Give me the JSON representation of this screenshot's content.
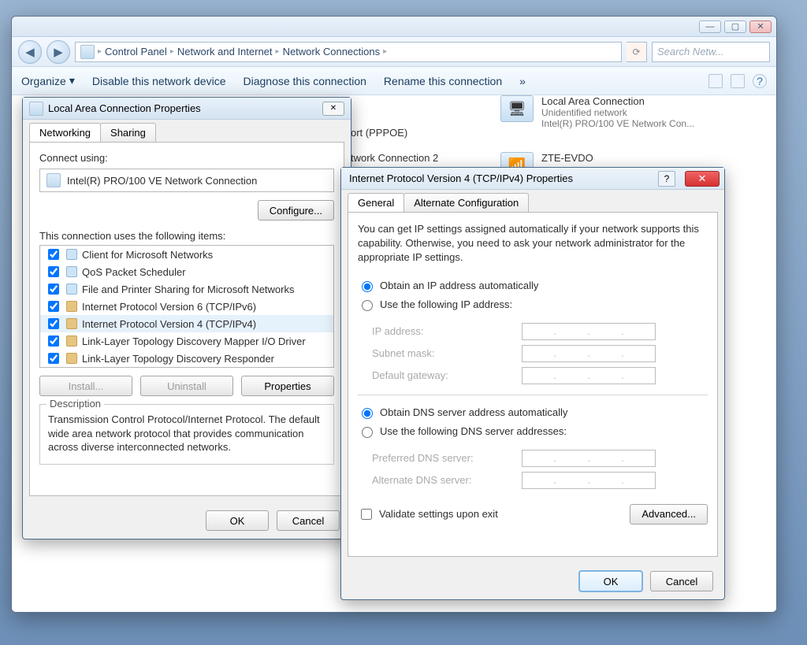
{
  "explorer": {
    "breadcrumb": {
      "part1": "Control Panel",
      "part2": "Network and Internet",
      "part3": "Network Connections"
    },
    "search_placeholder": "Search Netw...",
    "toolbar": {
      "organize": "Organize",
      "disable": "Disable this network device",
      "diagnose": "Diagnose this connection",
      "rename": "Rename this connection"
    },
    "connections": {
      "pppoe": "ort (PPPOE)",
      "bbconn2": "twork Connection 2",
      "lan_title": "Local Area Connection",
      "lan_status": "Unidentified network",
      "lan_adapter": "Intel(R) PRO/100 VE Network Con...",
      "zte": "ZTE-EVDO"
    }
  },
  "lacprops": {
    "title": "Local Area Connection Properties",
    "tabs": {
      "networking": "Networking",
      "sharing": "Sharing"
    },
    "connect_using_label": "Connect using:",
    "adapter": "Intel(R) PRO/100 VE Network Connection",
    "configure_btn": "Configure...",
    "items_label": "This connection uses the following items:",
    "items": [
      "Client for Microsoft Networks",
      "QoS Packet Scheduler",
      "File and Printer Sharing for Microsoft Networks",
      "Internet Protocol Version 6 (TCP/IPv6)",
      "Internet Protocol Version 4 (TCP/IPv4)",
      "Link-Layer Topology Discovery Mapper I/O Driver",
      "Link-Layer Topology Discovery Responder"
    ],
    "install_btn": "Install...",
    "uninstall_btn": "Uninstall",
    "properties_btn": "Properties",
    "description_label": "Description",
    "description_text": "Transmission Control Protocol/Internet Protocol. The default wide area network protocol that provides communication across diverse interconnected networks.",
    "ok": "OK",
    "cancel": "Cancel"
  },
  "ipv4": {
    "title": "Internet Protocol Version 4 (TCP/IPv4) Properties",
    "tabs": {
      "general": "General",
      "altconfig": "Alternate Configuration"
    },
    "intro": "You can get IP settings assigned automatically if your network supports this capability. Otherwise, you need to ask your network administrator for the appropriate IP settings.",
    "obtain_ip": "Obtain an IP address automatically",
    "use_ip": "Use the following IP address:",
    "ip_address_label": "IP address:",
    "subnet_label": "Subnet mask:",
    "gateway_label": "Default gateway:",
    "obtain_dns": "Obtain DNS server address automatically",
    "use_dns": "Use the following DNS server addresses:",
    "pref_dns_label": "Preferred DNS server:",
    "alt_dns_label": "Alternate DNS server:",
    "validate": "Validate settings upon exit",
    "advanced": "Advanced...",
    "ok": "OK",
    "cancel": "Cancel"
  }
}
